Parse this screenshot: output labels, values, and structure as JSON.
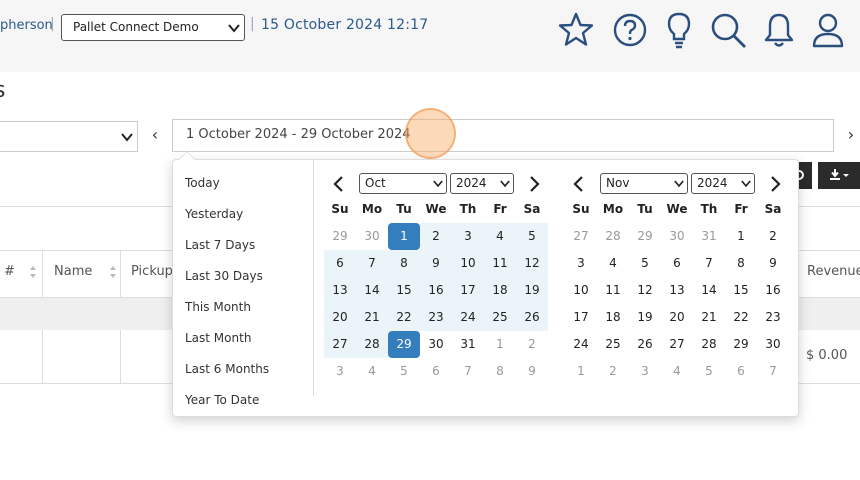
{
  "header": {
    "user_name": "pherson",
    "separator": "|",
    "company_selected": "Pallet Connect Demo",
    "datetime": "15 October 2024 12:17",
    "icons": [
      "star-icon",
      "help-circle-icon",
      "lightbulb-icon",
      "search-icon",
      "bell-icon",
      "user-icon"
    ]
  },
  "page": {
    "title": "s"
  },
  "filters": {
    "prev_label": "‹",
    "next_label": "›",
    "date_range_value": "1 October 2024 - 29 October 2024"
  },
  "table": {
    "headers": [
      "#",
      "Name",
      "Pickup",
      "Revenue"
    ],
    "rows": [
      {
        "revenue": "$ 0.00"
      }
    ]
  },
  "datepicker": {
    "ranges": [
      "Today",
      "Yesterday",
      "Last 7 Days",
      "Last 30 Days",
      "This Month",
      "Last Month",
      "Last 6 Months",
      "Year To Date"
    ],
    "weekdays": [
      "Su",
      "Mo",
      "Tu",
      "We",
      "Th",
      "Fr",
      "Sa"
    ],
    "left_calendar": {
      "month": "Oct",
      "year": "2024",
      "weeks": [
        [
          "29",
          "30",
          "1",
          "2",
          "3",
          "4",
          "5"
        ],
        [
          "6",
          "7",
          "8",
          "9",
          "10",
          "11",
          "12"
        ],
        [
          "13",
          "14",
          "15",
          "16",
          "17",
          "18",
          "19"
        ],
        [
          "20",
          "21",
          "22",
          "23",
          "24",
          "25",
          "26"
        ],
        [
          "27",
          "28",
          "29",
          "30",
          "31",
          "1",
          "2"
        ],
        [
          "3",
          "4",
          "5",
          "6",
          "7",
          "8",
          "9"
        ]
      ]
    },
    "right_calendar": {
      "month": "Nov",
      "year": "2024",
      "weeks": [
        [
          "27",
          "28",
          "29",
          "30",
          "31",
          "1",
          "2"
        ],
        [
          "3",
          "4",
          "5",
          "6",
          "7",
          "8",
          "9"
        ],
        [
          "10",
          "11",
          "12",
          "13",
          "14",
          "15",
          "16"
        ],
        [
          "17",
          "18",
          "19",
          "20",
          "21",
          "22",
          "23"
        ],
        [
          "24",
          "25",
          "26",
          "27",
          "28",
          "29",
          "30"
        ],
        [
          "1",
          "2",
          "3",
          "4",
          "5",
          "6",
          "7"
        ]
      ]
    }
  },
  "colors": {
    "accent": "#357ebd",
    "in_range": "#ebf4f8",
    "link": "#2a5a8c"
  }
}
